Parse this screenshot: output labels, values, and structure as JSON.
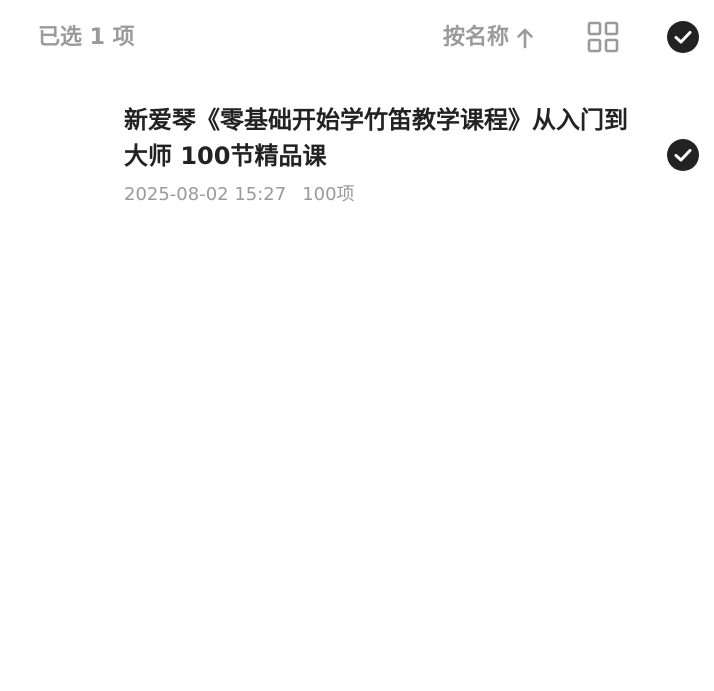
{
  "toolbar": {
    "selected_count": "已选 1 项",
    "sort_label": "按名称",
    "sort_direction": "ascending",
    "sort_icon": "arrow-up-icon",
    "view_icon": "grid-view-icon",
    "select_all_icon": "check-circle-icon",
    "select_all_checked": true
  },
  "files": [
    {
      "name": "新爱琴《零基础开始学竹笛教学课程》从入门到大师 100节精品课",
      "date": "2025-08-02 15:27",
      "count": "100项",
      "checked": true
    }
  ],
  "colors": {
    "muted_text": "#9a9a9a",
    "primary_text": "#222222",
    "check_fill": "#222222",
    "background": "#ffffff"
  }
}
